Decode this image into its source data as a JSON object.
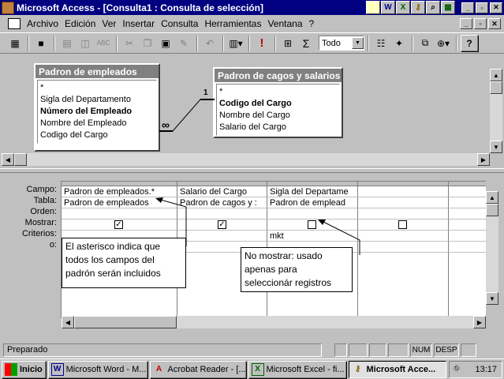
{
  "window": {
    "title": "Microsoft Access - [Consulta1 : Consulta de selección]",
    "quick_icons": [
      "",
      "W",
      "",
      "",
      "",
      ""
    ],
    "controls": {
      "minimize": "_",
      "restore": "▫",
      "close": "✕"
    }
  },
  "menu": {
    "items": [
      "Archivo",
      "Edición",
      "Ver",
      "Insertar",
      "Consulta",
      "Herramientas",
      "Ventana",
      "?"
    ],
    "doc_controls": {
      "minimize": "_",
      "restore": "▫",
      "close": "✕"
    }
  },
  "toolbar": {
    "top_values_value": "Todo",
    "buttons": [
      "view-icon",
      "save-icon",
      "print-icon",
      "preview-icon",
      "spelling-icon",
      "cut-icon",
      "copy-icon",
      "paste-icon",
      "format-painter-icon",
      "undo-icon",
      "query-type-icon",
      "run-icon",
      "show-table-icon",
      "totals-icon",
      "properties-icon",
      "build-icon",
      "database-window-icon",
      "new-object-icon",
      "help-icon"
    ],
    "run_symbol": "!",
    "totals_symbol": "Σ",
    "help_symbol": "?"
  },
  "tables": [
    {
      "title": "Padron de empleados",
      "fields": [
        {
          "name": "*",
          "bold": false
        },
        {
          "name": "Sigla del Departamento",
          "bold": false
        },
        {
          "name": "Número del Empleado",
          "bold": true
        },
        {
          "name": "Nombre del Empleado",
          "bold": false
        },
        {
          "name": "Codigo del Cargo",
          "bold": false
        }
      ]
    },
    {
      "title": "Padron de cagos y salarios",
      "fields": [
        {
          "name": "*",
          "bold": false
        },
        {
          "name": "Codigo del Cargo",
          "bold": true
        },
        {
          "name": "Nombre del Cargo",
          "bold": false
        },
        {
          "name": "Salario del Cargo",
          "bold": false
        }
      ]
    }
  ],
  "relationship": {
    "one_side": "1",
    "many_side": "∞"
  },
  "grid": {
    "row_labels": [
      "Campo:",
      "Tabla:",
      "Orden:",
      "Mostrar:",
      "Criterios:",
      "o:"
    ],
    "columns": [
      {
        "campo": "Padron de empleados.*",
        "tabla": "Padron de empleados",
        "orden": "",
        "mostrar": true,
        "criterios": ""
      },
      {
        "campo": "Salario del Cargo",
        "tabla": "Padron de cagos y :",
        "orden": "",
        "mostrar": true,
        "criterios": ""
      },
      {
        "campo": "Sigla del Departame",
        "tabla": "Padron de emplead",
        "orden": "",
        "mostrar": false,
        "criterios": "mkt"
      },
      {
        "campo": "",
        "tabla": "",
        "orden": "",
        "mostrar": false,
        "criterios": ""
      },
      {
        "campo": "",
        "tabla": "",
        "orden": "",
        "mostrar": null,
        "criterios": ""
      }
    ],
    "check_mark": "✓"
  },
  "callouts": [
    {
      "text_lines": [
        "El asterisco indica que",
        "todos los campos del",
        "padrón serán incluidos"
      ]
    },
    {
      "text_lines": [
        "No mostrar: usado",
        "apenas para",
        "seleccionár registros"
      ]
    }
  ],
  "status": {
    "text": "Preparado",
    "num": "NUM",
    "desp": "DESP"
  },
  "taskbar": {
    "start": "Inicio",
    "tasks": [
      {
        "label": "Microsoft Word - M...",
        "icon": "W",
        "active": false
      },
      {
        "label": "Acrobat Reader - [...",
        "icon": "A",
        "active": false
      },
      {
        "label": "Microsoft Excel - fi...",
        "icon": "X",
        "active": false
      },
      {
        "label": "Microsoft Acce...",
        "icon": "K",
        "active": true
      }
    ],
    "clock": "13:17"
  }
}
